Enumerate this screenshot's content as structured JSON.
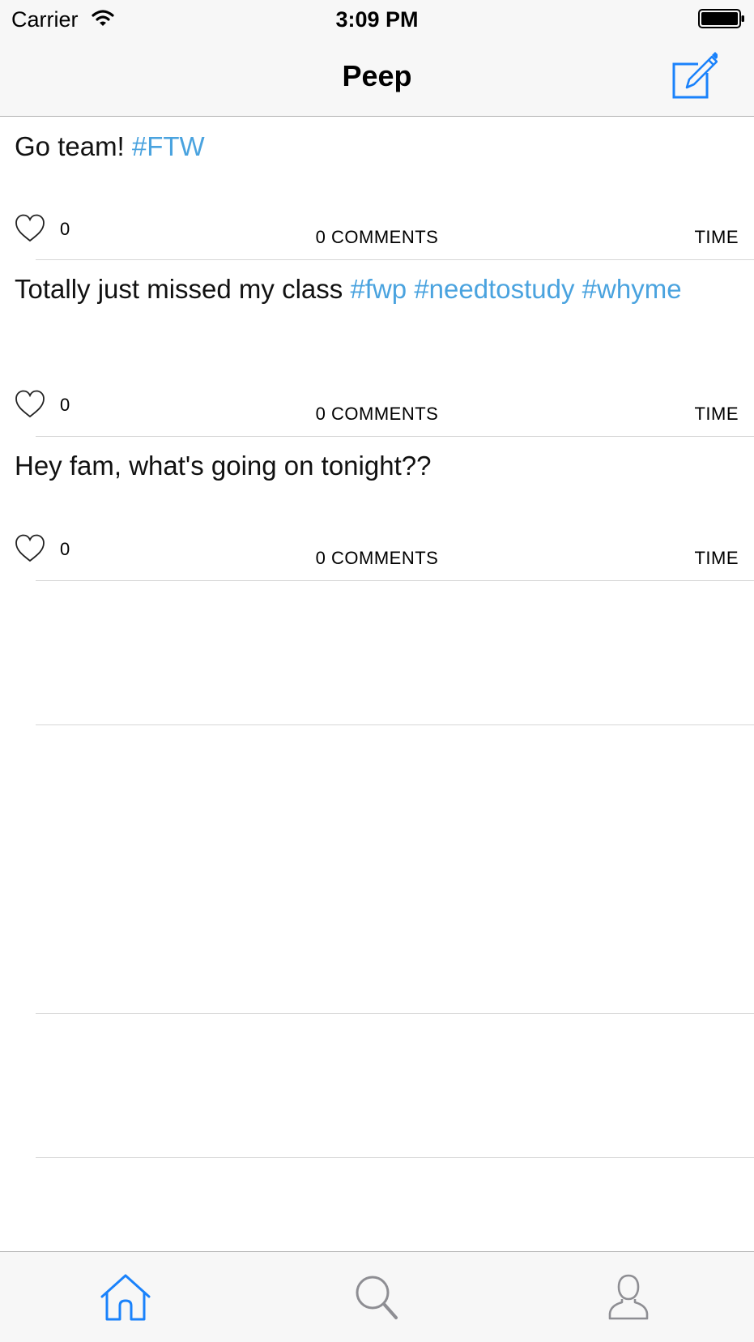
{
  "status_bar": {
    "carrier": "Carrier",
    "time": "3:09 PM"
  },
  "nav": {
    "title": "Peep",
    "compose_icon": "compose-icon"
  },
  "posts": [
    {
      "text": "Go team! ",
      "hashtags": [
        "#FTW"
      ],
      "likes": "0",
      "comments": "0 COMMENTS",
      "time": "TIME"
    },
    {
      "text": "Totally just missed my class ",
      "hashtags": [
        "#fwp",
        "#needtostudy",
        "#whyme"
      ],
      "likes": "0",
      "comments": "0 COMMENTS",
      "time": "TIME"
    },
    {
      "text": "Hey fam, what's going on tonight??",
      "hashtags": [],
      "likes": "0",
      "comments": "0 COMMENTS",
      "time": "TIME"
    }
  ],
  "tab_bar": {
    "tabs": [
      {
        "icon": "home-icon",
        "selected": true
      },
      {
        "icon": "search-icon",
        "selected": false
      },
      {
        "icon": "profile-icon",
        "selected": false
      }
    ]
  },
  "colors": {
    "accent": "#1a82fb",
    "hashtag": "#4aa3df",
    "inactive_icon": "#8e8e93",
    "bar_background": "#f7f7f7",
    "separator": "#d6d6d6"
  }
}
